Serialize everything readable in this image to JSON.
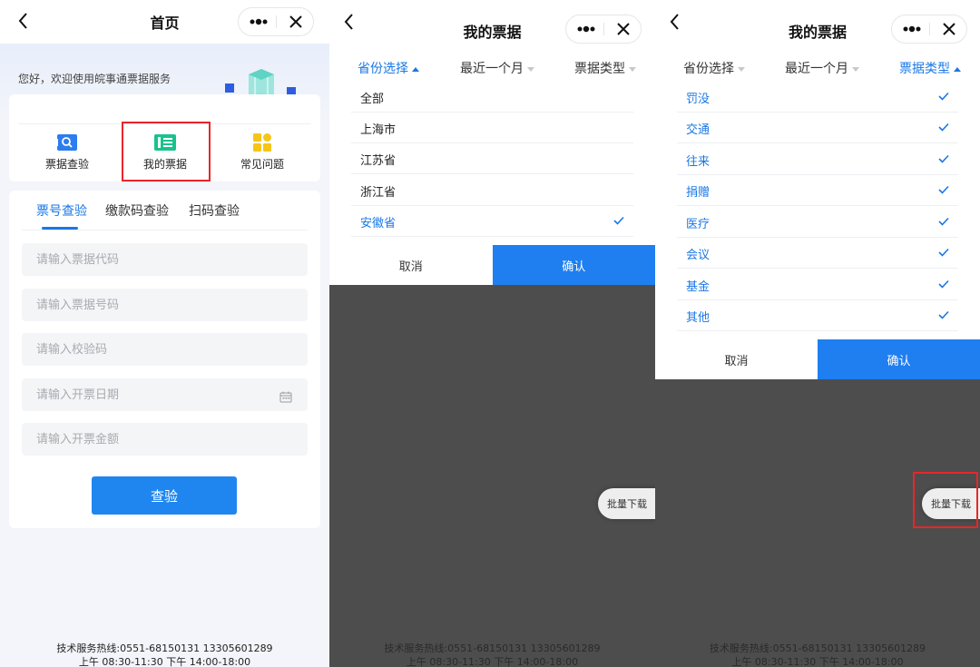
{
  "colors": {
    "accent": "#1a77e6",
    "highlight": "#e8262a",
    "overlay": "#4d4d4d"
  },
  "home": {
    "title": "首页",
    "greeting": "您好，欢迎使用皖事通票据服务",
    "shortcuts": [
      {
        "label": "票据查验",
        "icon": "ticket-search-icon"
      },
      {
        "label": "我的票据",
        "icon": "my-ticket-icon"
      },
      {
        "label": "常见问题",
        "icon": "faq-grid-icon"
      }
    ],
    "tabs": [
      "票号查验",
      "缴款码查验",
      "扫码查验"
    ],
    "placeholders": {
      "code": "请输入票据代码",
      "number": "请输入票据号码",
      "check": "请输入校验码",
      "date": "请输入开票日期",
      "amount": "请输入开票金额"
    },
    "submit_label": "查验"
  },
  "tickets": {
    "title": "我的票据",
    "filters": [
      "省份选择",
      "最近一个月",
      "票据类型"
    ],
    "provinces": [
      {
        "label": "全部"
      },
      {
        "label": "上海市"
      },
      {
        "label": "江苏省"
      },
      {
        "label": "浙江省"
      },
      {
        "label": "安徽省"
      }
    ],
    "types": [
      {
        "label": "罚没"
      },
      {
        "label": "交通"
      },
      {
        "label": "往来"
      },
      {
        "label": "捐赠"
      },
      {
        "label": "医疗"
      },
      {
        "label": "会议"
      },
      {
        "label": "基金"
      },
      {
        "label": "其他"
      }
    ],
    "cancel_label": "取消",
    "confirm_label": "确认",
    "batch_label": "批量下载"
  },
  "footer": {
    "line1": "技术服务热线:0551-68150131 13305601289",
    "line2": "上午 08:30-11:30 下午 14:00-18:00"
  }
}
